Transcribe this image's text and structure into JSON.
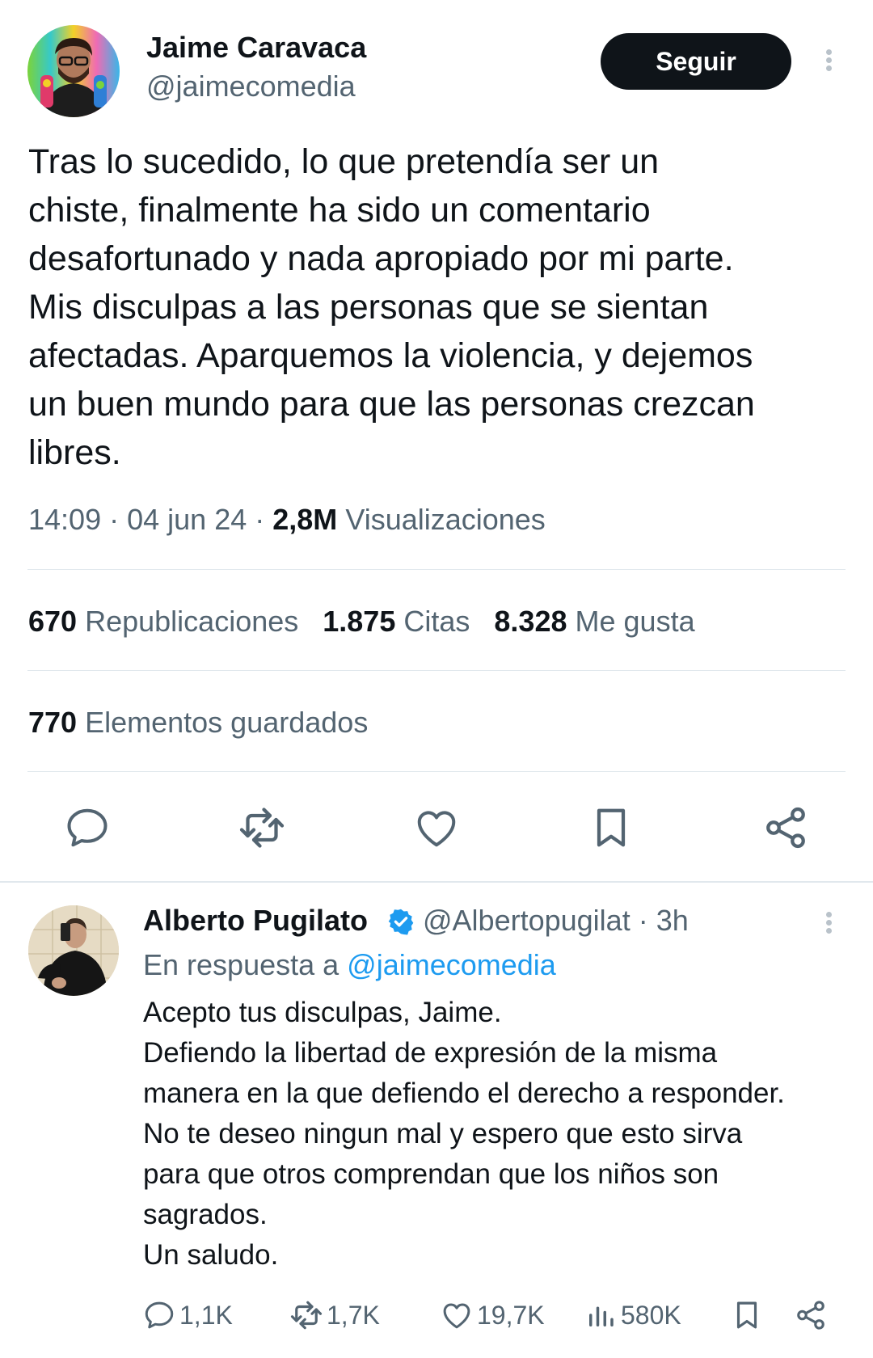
{
  "tweet": {
    "author_name": "Jaime Caravaca",
    "author_handle": "@jaimecomedia",
    "follow_label": "Seguir",
    "text": "Tras lo sucedido, lo que pretendía ser un\nchiste, finalmente ha sido un comentario\ndesafortunado y nada apropiado por mi parte.\nMis disculpas a las personas que se sientan\nafectadas. Aparquemos la violencia, y dejemos\nun buen mundo para que las personas crezcan\nlibres.",
    "time": "14:09",
    "date": "04 jun 24",
    "views_count": "2,8M",
    "views_label": "Visualizaciones",
    "stats": {
      "reposts_count": "670",
      "reposts_label": "Republicaciones",
      "quotes_count": "1.875",
      "quotes_label": "Citas",
      "likes_count": "8.328",
      "likes_label": "Me gusta",
      "bookmarks_count": "770",
      "bookmarks_label": "Elementos guardados"
    },
    "actions": [
      "reply-icon",
      "retweet-icon",
      "like-icon",
      "bookmark-icon",
      "share-icon"
    ]
  },
  "reply": {
    "author_name": "Alberto Pugilato",
    "author_handle": "@Albertopugilat",
    "time_ago": "3h",
    "reply_to_prefix": "En respuesta a",
    "reply_to_handle": "@jaimecomedia",
    "text": "Acepto tus disculpas, Jaime.\nDefiendo la libertad de expresión de la misma\nmanera en la que defiendo el derecho a responder.\nNo te deseo ningun mal y espero que esto sirva\npara que otros comprendan que los niños son\nsagrados.\nUn saludo.",
    "replies": "1,1K",
    "reposts": "1,7K",
    "likes": "19,7K",
    "views": "580K"
  },
  "colors": {
    "text": "#0f1419",
    "secondary": "#536471",
    "link": "#1d9bf0",
    "verified": "#1d9bf0",
    "divider": "#e1e8ed"
  }
}
